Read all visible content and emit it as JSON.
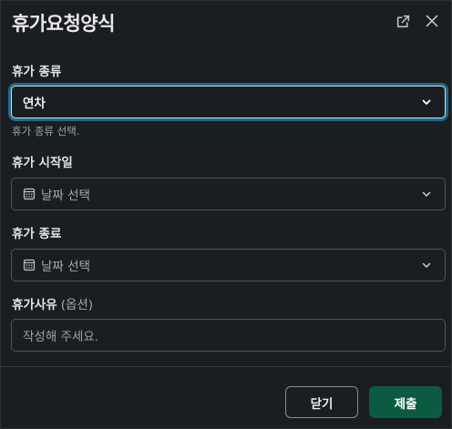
{
  "modal": {
    "title": "휴가요청양식",
    "icons": {
      "external": "external-link-icon",
      "close": "close-icon"
    }
  },
  "fields": {
    "leave_type": {
      "label": "휴가 종류",
      "value": "연차",
      "hint": "휴가 종류 선택."
    },
    "start_date": {
      "label": "휴가 시작일",
      "placeholder": "날짜 선택"
    },
    "end_date": {
      "label": "휴가 종료",
      "placeholder": "날짜 선택"
    },
    "reason": {
      "label": "휴가사유",
      "optional": "(옵션)",
      "placeholder": "작성해 주세요."
    }
  },
  "footer": {
    "close_label": "닫기",
    "submit_label": "제출"
  },
  "colors": {
    "submit_bg": "#0d5a43",
    "focus_ring": "#1d6b8a",
    "background": "#1a1d21"
  }
}
